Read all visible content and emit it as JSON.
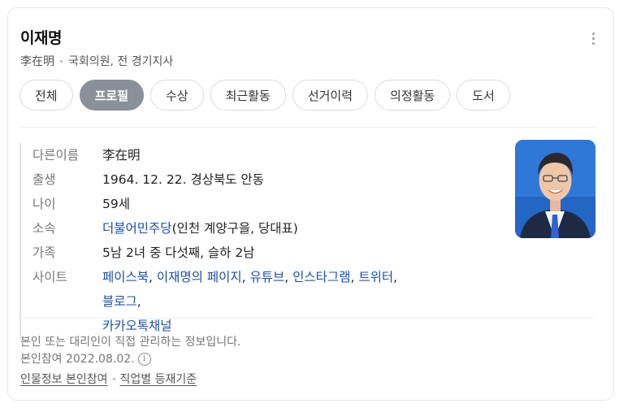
{
  "header": {
    "name": "이재명",
    "hanja": "李在明",
    "role": "국회의원, 전 경기지사"
  },
  "tabs": [
    {
      "label": "전체",
      "active": false
    },
    {
      "label": "프로필",
      "active": true
    },
    {
      "label": "수상",
      "active": false
    },
    {
      "label": "최근활동",
      "active": false
    },
    {
      "label": "선거이력",
      "active": false
    },
    {
      "label": "의정활동",
      "active": false
    },
    {
      "label": "도서",
      "active": false
    }
  ],
  "profile": {
    "alias_label": "다른이름",
    "alias_value": "李在明",
    "birth_label": "출생",
    "birth_value": "1964. 12. 22. 경상북도 안동",
    "age_label": "나이",
    "age_value": "59세",
    "affiliation_label": "소속",
    "affiliation_link": "더불어민주당",
    "affiliation_rest": "(인천 계양구을, 당대표)",
    "family_label": "가족",
    "family_value": "5남 2녀 중 다섯째, 슬하 2남",
    "site_label": "사이트",
    "sites": [
      "페이스북",
      "이재명의 페이지",
      "유튜브",
      "인스타그램",
      "트위터",
      "블로그",
      "카카오톡채널"
    ]
  },
  "footer": {
    "notice": "본인 또는 대리인이 직접 관리하는 정보입니다.",
    "verified": "본인참여 2022.08.02.",
    "info_icon": "info-icon",
    "link1": "인물정보 본인참여",
    "link2": "직업별 등재기준"
  },
  "colors": {
    "accent_link": "#1b4fa8",
    "active_tab": "#8a9099"
  }
}
